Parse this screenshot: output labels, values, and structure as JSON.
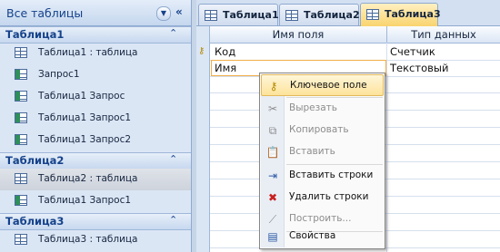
{
  "nav": {
    "title": "Все таблицы",
    "groups": [
      {
        "name": "Таблица1",
        "items": [
          {
            "label": "Таблица1 : таблица",
            "icon": "table-icon"
          },
          {
            "label": "Запрос1",
            "icon": "query-icon"
          },
          {
            "label": "Таблица1 Запрос",
            "icon": "query-icon"
          },
          {
            "label": "Таблица1 Запрос1",
            "icon": "query-icon"
          },
          {
            "label": "Таблица1 Запрос2",
            "icon": "query-icon"
          }
        ]
      },
      {
        "name": "Таблица2",
        "items": [
          {
            "label": "Таблица2 : таблица",
            "icon": "table-icon",
            "selected": true
          },
          {
            "label": "Таблица1 Запрос1",
            "icon": "query-icon"
          }
        ]
      },
      {
        "name": "Таблица3",
        "items": [
          {
            "label": "Таблица3 : таблица",
            "icon": "table-icon"
          }
        ]
      }
    ]
  },
  "tabs": [
    {
      "label": "Таблица1",
      "active": false
    },
    {
      "label": "Таблица2",
      "active": false
    },
    {
      "label": "Таблица3",
      "active": true
    }
  ],
  "grid": {
    "headers": [
      "Имя поля",
      "Тип данных"
    ],
    "rows": [
      {
        "field": "Код",
        "type": "Счетчик",
        "primary_key": true
      },
      {
        "field": "Имя",
        "type": "Текстовый",
        "primary_key": false
      }
    ]
  },
  "context_menu": {
    "items": [
      {
        "label": "Ключевое поле",
        "icon": "key-icon",
        "enabled": true,
        "highlighted": true
      },
      {
        "label": "Вырезать",
        "icon": "scissors-icon",
        "enabled": false
      },
      {
        "label": "Копировать",
        "icon": "copy-icon",
        "enabled": false
      },
      {
        "label": "Вставить",
        "icon": "paste-icon",
        "enabled": false
      },
      {
        "label": "Вставить строки",
        "icon": "insert-rows-icon",
        "enabled": true
      },
      {
        "label": "Удалить строки",
        "icon": "delete-rows-icon",
        "enabled": true
      },
      {
        "label": "Построить...",
        "icon": "builder-icon",
        "enabled": false
      },
      {
        "label": "Свойства",
        "icon": "properties-icon",
        "enabled": true
      }
    ]
  },
  "colors": {
    "nav_bg": "#dbe6f5",
    "group_header": "#c7d8ef",
    "active_tab": "#f9d36e",
    "menu_highlight": "#fde39a"
  }
}
